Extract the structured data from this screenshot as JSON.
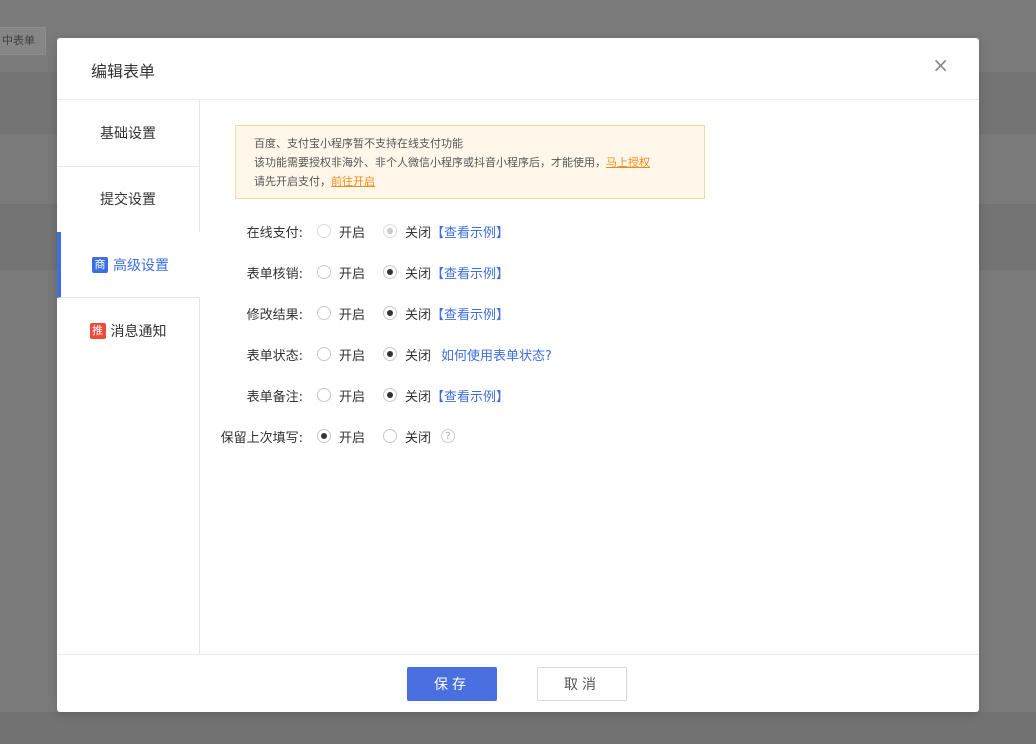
{
  "background": {
    "button_label": "中表单"
  },
  "modal": {
    "title": "编辑表单",
    "close_label": "×"
  },
  "sidebar": {
    "items": [
      {
        "label": "基础设置",
        "badge": ""
      },
      {
        "label": "提交设置",
        "badge": ""
      },
      {
        "label": "高级设置",
        "badge": "商"
      },
      {
        "label": "消息通知",
        "badge": "推"
      }
    ]
  },
  "notice": {
    "line1": "百度、支付宝小程序暂不支持在线支付功能",
    "line2": "该功能需要授权非海外、非个人微信小程序或抖音小程序后，才能使用，",
    "line2_link": "马上授权",
    "line3": "请先开启支付，",
    "line3_link": "前往开启"
  },
  "options": {
    "on_label": "开启",
    "off_label": "关闭",
    "example_link": "【查看示例】",
    "help_icon": "?"
  },
  "rows": [
    {
      "label": "在线支付:",
      "value": "off",
      "disabled": true,
      "link": "【查看示例】"
    },
    {
      "label": "表单核销:",
      "value": "off",
      "disabled": false,
      "link": "【查看示例】"
    },
    {
      "label": "修改结果:",
      "value": "off",
      "disabled": false,
      "link": "【查看示例】"
    },
    {
      "label": "表单状态:",
      "value": "off",
      "disabled": false,
      "link": "如何使用表单状态?"
    },
    {
      "label": "表单备注:",
      "value": "off",
      "disabled": false,
      "link": "【查看示例】"
    },
    {
      "label": "保留上次填写:",
      "value": "on",
      "disabled": false,
      "link": ""
    }
  ],
  "footer": {
    "save_label": "保存",
    "cancel_label": "取消"
  },
  "colors": {
    "accent": "#3e6fe0",
    "badge_red": "#ee4a3a",
    "notice_bg": "#fff8ea",
    "link_orange": "#f08a1c"
  }
}
